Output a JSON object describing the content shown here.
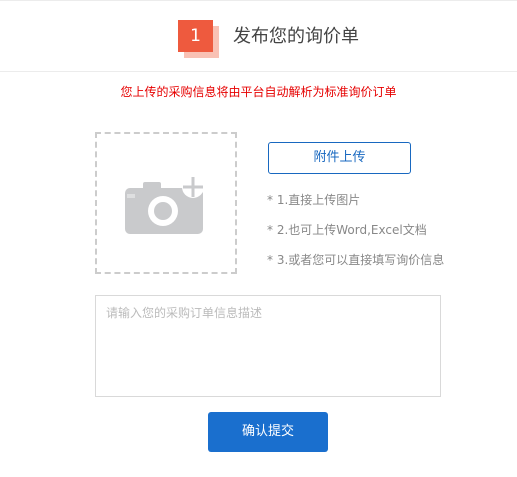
{
  "header": {
    "step_number": "1",
    "title": "发布您的询价单"
  },
  "notice": "您上传的采购信息将由平台自动解析为标准询价订单",
  "upload": {
    "icon": "add-photo-camera-icon",
    "button_label": "附件上传"
  },
  "tips": [
    "* 1.直接上传图片",
    "* 2.也可上传Word,Excel文档",
    "* 3.或者您可以直接填写询价信息"
  ],
  "description": {
    "value": "",
    "placeholder": "请输入您的采购订单信息描述"
  },
  "submit_label": "确认提交",
  "colors": {
    "accent_blue": "#1a6fce",
    "notice_red": "#e60000",
    "step_orange": "#ee5a3e"
  }
}
